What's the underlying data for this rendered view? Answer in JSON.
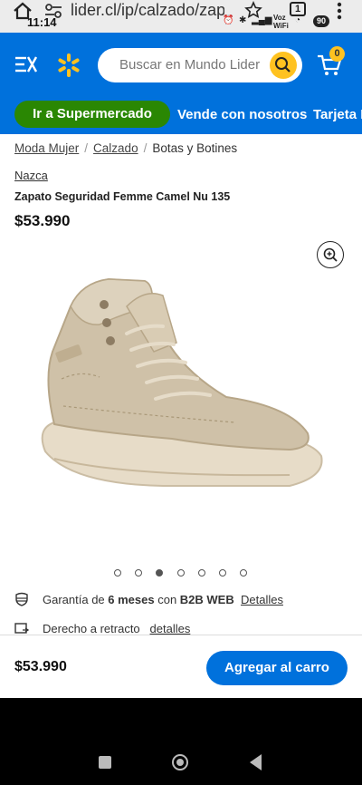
{
  "browser": {
    "url": "lider.cl/ip/calzado/zapato",
    "time": "11:14",
    "tab_count": "1",
    "status_labels": [
      "Voz",
      "WiFi"
    ],
    "battery": "90"
  },
  "header": {
    "search_placeholder": "Buscar en Mundo Lider",
    "cart_count": "0",
    "colors": {
      "brand_blue": "#0071dc",
      "accent_yellow": "#ffc220",
      "green": "#2a8703"
    }
  },
  "nav": {
    "pill": "Ir a Supermercado",
    "links": [
      "Vende con nosotros",
      "Tarjeta L"
    ]
  },
  "breadcrumb": {
    "items": [
      "Moda Mujer",
      "Calzado",
      "Botas y Botines"
    ]
  },
  "product": {
    "brand": "Nazca",
    "title": "Zapato Seguridad Femme Camel Nu 135",
    "price": "$53.990",
    "image_count": 7,
    "active_image": 3
  },
  "info": {
    "warranty_prefix": "Garantía de ",
    "warranty_bold": "6 meses",
    "warranty_mid": " con ",
    "warranty_provider": "B2B WEB",
    "warranty_link": "Detalles",
    "retract_label": "Derecho a retracto",
    "retract_link": "detalles"
  },
  "footer": {
    "price": "$53.990",
    "add_button": "Agregar al carro"
  }
}
